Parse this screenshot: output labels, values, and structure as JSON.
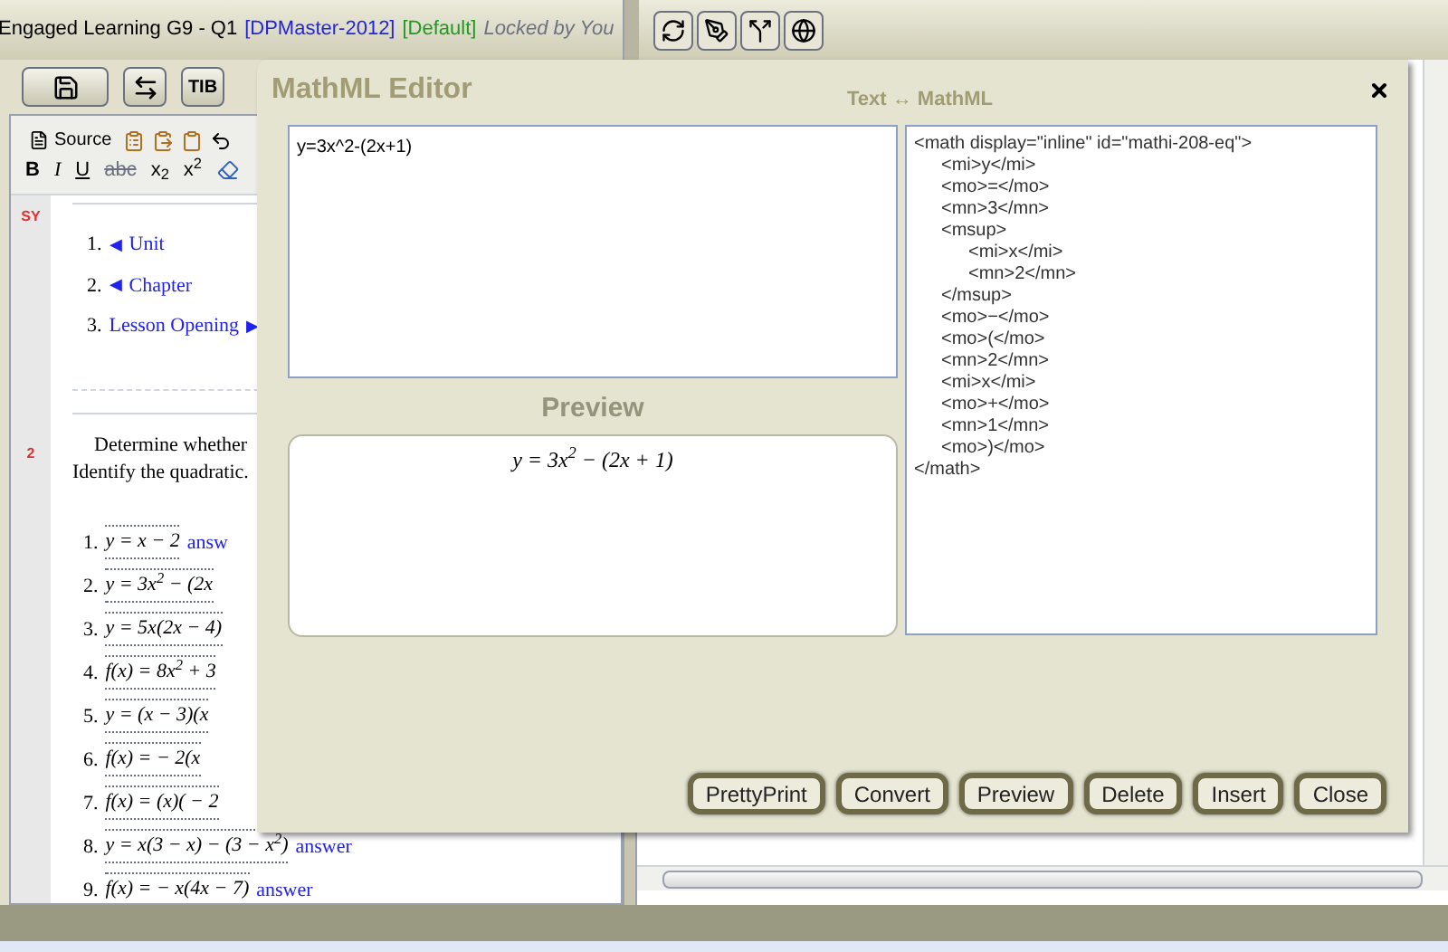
{
  "header": {
    "title": "Engaged Learning G9 - Q1",
    "project": "[DPMaster-2012]",
    "mode": "[Default]",
    "lock": "Locked by You"
  },
  "left_toolbar": {
    "tib_button": "TIB"
  },
  "editor_toolbar": {
    "source_button": "Source",
    "format_buttons": [
      {
        "kind": "bold",
        "label": "B"
      },
      {
        "kind": "italic",
        "label": "I"
      },
      {
        "kind": "underline",
        "label": "U"
      },
      {
        "kind": "strike",
        "label": "abc"
      },
      {
        "kind": "subscript",
        "label": "x$_{2}$"
      },
      {
        "kind": "superscript",
        "label": "x$^{2}$"
      }
    ]
  },
  "document": {
    "markers": [
      "SY",
      "2"
    ],
    "nav_links": [
      {
        "number": "1.",
        "prefix": "◀",
        "label": "Unit"
      },
      {
        "number": "2.",
        "prefix": "◀",
        "label": "Chapter"
      },
      {
        "number": "3.",
        "label": "Lesson Opening",
        "suffix": "▶"
      }
    ],
    "instructions": [
      "Determine whether",
      "Identify the quadratic."
    ],
    "problems": [
      {
        "number": "1.",
        "equation": "y = x − 2",
        "answer": "answ"
      },
      {
        "number": "2.",
        "equation": "y = 3x$^{2}$ − (2x"
      },
      {
        "number": "3.",
        "equation": "y = 5x(2x − 4)"
      },
      {
        "number": "4.",
        "equation": "f(x) = 8x$^{2}$ + 3"
      },
      {
        "number": "5.",
        "equation": "y = (x − 3)(x"
      },
      {
        "number": "6.",
        "equation": "f(x) = − 2(x"
      },
      {
        "number": "7.",
        "equation": "f(x) = (x)( − 2"
      },
      {
        "number": "8.",
        "equation": "y = x(3 − x) − (3 − x$^{2}$)",
        "answer": "answer"
      },
      {
        "number": "9.",
        "equation": "f(x) = − x(4x − 7)",
        "answer": "answer"
      }
    ]
  },
  "dialog": {
    "title": "MathML Editor",
    "subtitle": "Text ↔ MathML",
    "input": "y=3x^2-(2x+1)",
    "preview_label": "Preview",
    "preview": "y = 3x$^{2}$ − (2x + 1)",
    "mathml": [
      {
        "text": "<math display=\"inline\" id=\"mathi-208-eq\">",
        "children": [
          {
            "text": "<mi>y</mi>"
          },
          {
            "text": "<mo>=</mo>"
          },
          {
            "text": "<mn>3</mn>"
          },
          {
            "text": "<msup>",
            "children": [
              {
                "text": "<mi>x</mi>"
              },
              {
                "text": "<mn>2</mn>"
              }
            ]
          },
          {
            "text": "</msup>"
          },
          {
            "text": "<mo>−</mo>"
          },
          {
            "text": "<mo>(</mo>"
          },
          {
            "text": "<mn>2</mn>"
          },
          {
            "text": "<mi>x</mi>"
          },
          {
            "text": "<mo>+</mo>"
          },
          {
            "text": "<mn>1</mn>"
          },
          {
            "text": "<mo>)</mo>"
          }
        ]
      },
      {
        "text": "</math>"
      }
    ],
    "buttons": [
      "PrettyPrint",
      "Convert",
      "Preview",
      "Delete",
      "Insert",
      "Close"
    ]
  }
}
